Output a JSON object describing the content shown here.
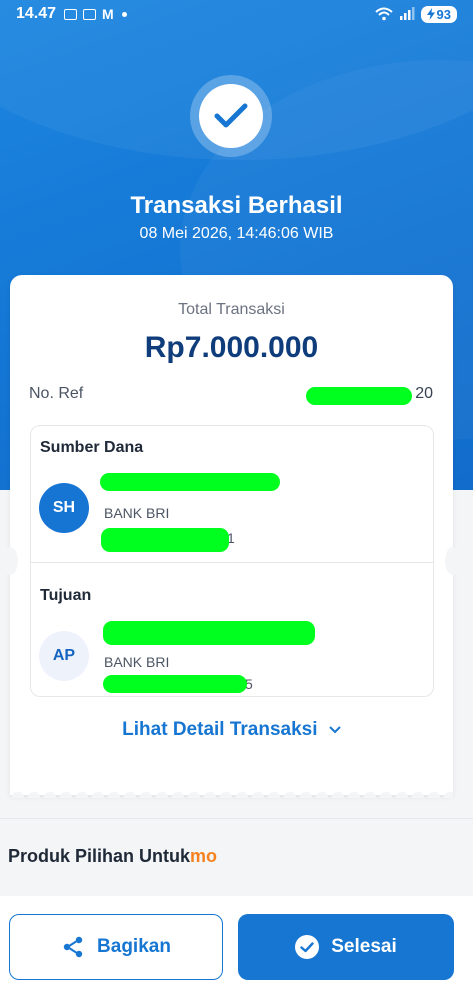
{
  "status_bar": {
    "time": "14.47",
    "battery": "93"
  },
  "hero": {
    "title": "Transaksi Berhasil",
    "datetime": "08 Mei 2026, 14:46:06 WIB"
  },
  "summary": {
    "total_label": "Total Transaksi",
    "total_value": "Rp7.000.000",
    "ref_label": "No. Ref",
    "ref_suffix": "20"
  },
  "source": {
    "heading": "Sumber Dana",
    "initials": "SH",
    "bank": "BANK BRI",
    "account_suffix": "1"
  },
  "destination": {
    "heading": "Tujuan",
    "initials": "AP",
    "bank": "BANK BRI",
    "account_suffix": "5"
  },
  "detail_link": "Lihat Detail Transaksi",
  "products": {
    "label": "Produk Pilihan Untuk",
    "brand": "mo"
  },
  "buttons": {
    "share": "Bagikan",
    "done": "Selesai"
  },
  "colors": {
    "primary": "#1676d2",
    "header_blue": "#1476d4",
    "amount_navy": "#0f3c7a",
    "brand_orange": "#f58220",
    "redaction_green": "#00ff1f"
  },
  "icons": {
    "success": "check-icon",
    "share": "share-icon",
    "done": "check-circle-icon",
    "expand": "chevron-down-icon"
  }
}
